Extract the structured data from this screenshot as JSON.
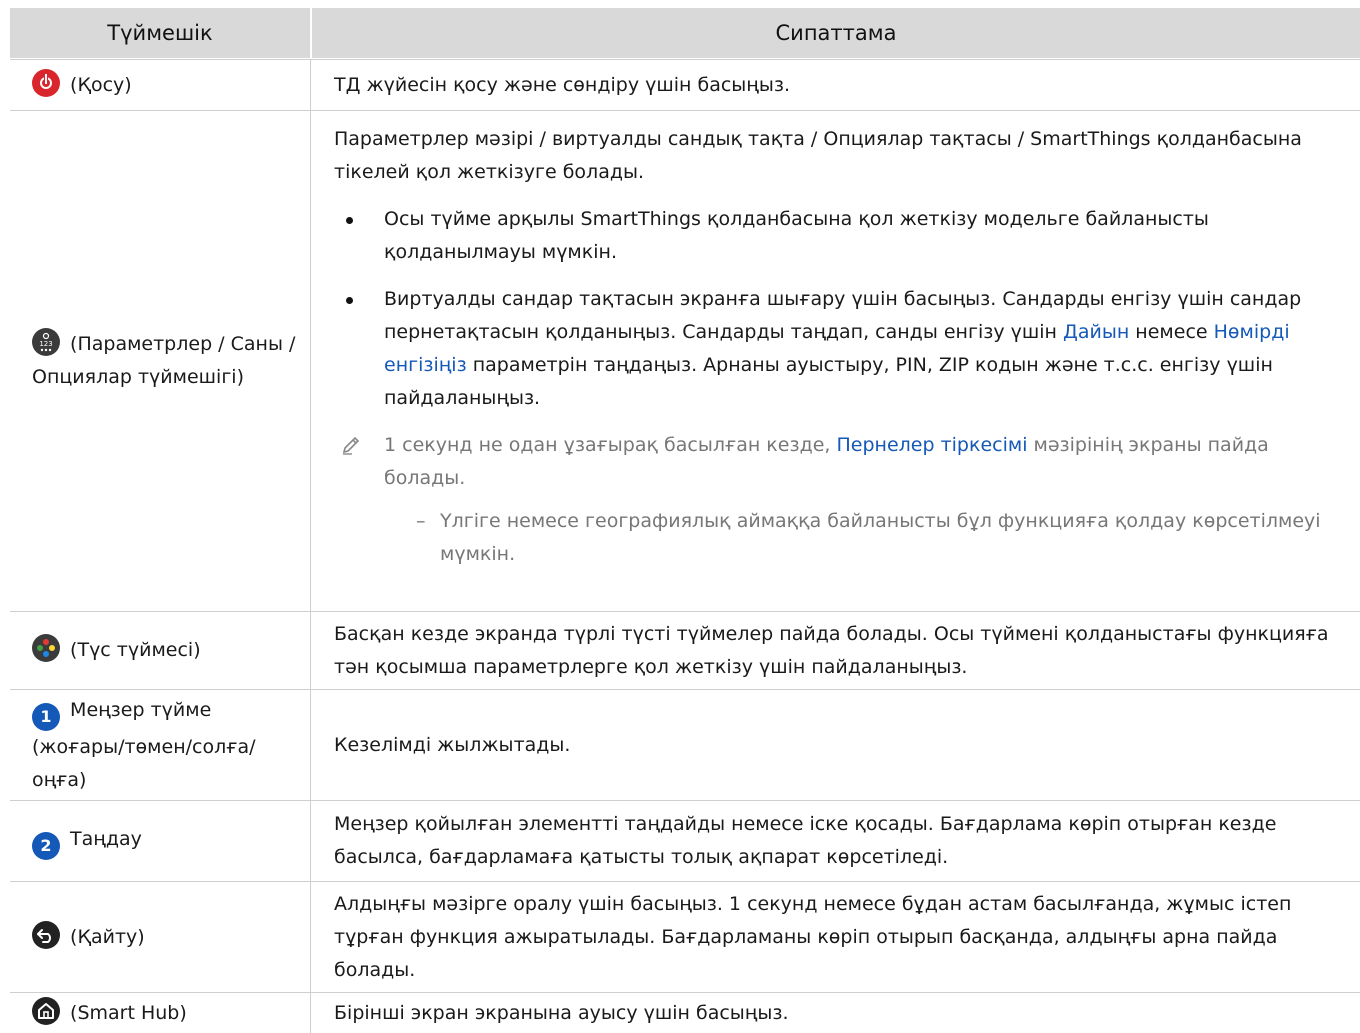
{
  "header": {
    "col1": "Түймешік",
    "col2": "Сипаттама"
  },
  "rows": {
    "power": {
      "label": "(Қосу)",
      "desc": "ТД жүйесін қосу және сөндіру үшін басыңыз."
    },
    "settings": {
      "label": "(Параметрлер / Саны / Опциялар түймешігі)",
      "desc": "Параметрлер мәзірі / виртуалды сандық тақта / Опциялар тақтасы / SmartThings қолданбасына тікелей қол жеткізуге болады.",
      "bullet1": "Осы түйме арқылы SmartThings қолданбасына қол жеткізу модельге байланысты қолданылмауы мүмкін.",
      "bullet2_a": "Виртуалды сандар тақтасын экранға шығару үшін басыңыз. Сандарды енгізу үшін сандар пернетақтасын қолданыңыз. Сандарды таңдап, санды енгізу үшін ",
      "bullet2_link1": "Дайын",
      "bullet2_b": " немесе ",
      "bullet2_link2": "Нөмірді енгізіңіз",
      "bullet2_c": " параметрін таңдаңыз. Арнаны ауыстыру, PIN, ZIP кодын және т.с.с. енгізу үшін пайдаланыңыз.",
      "note_a": "1 секунд не одан ұзағырақ басылған кезде, ",
      "note_link": "Пернелер тіркесімі",
      "note_b": " мәзірінің экраны пайда болады.",
      "dash_mark": "–",
      "dash": "Үлгіге немесе географиялық аймаққа байланысты бұл функцияға қолдау көрсетілмеуі мүмкін."
    },
    "color": {
      "label": "(Түс түймесі)",
      "desc": "Басқан кезде экранда түрлі түсті түймелер пайда болады. Осы түймені қолданыстағы функцияға тән қосымша параметрлерге қол жеткізу үшін пайдаланыңыз."
    },
    "direction": {
      "badge": "1",
      "label": "Меңзер түйме (жоғары/төмен/солға/оңға)",
      "desc": "Кезелімді жылжытады."
    },
    "select": {
      "badge": "2",
      "label": "Таңдау",
      "desc": "Меңзер қойылған элементті таңдайды немесе іске қосады. Бағдарлама көріп отырған кезде басылса, бағдарламаға қатысты толық ақпарат көрсетіледі."
    },
    "return": {
      "label": "(Қайту)",
      "desc": "Алдыңғы мәзірге оралу үшін басыңыз. 1 секунд немесе бұдан астам басылғанда, жұмыс істеп тұрған функция ажыратылады. Бағдарламаны көріп отырып басқанда, алдыңғы арна пайда болады."
    },
    "smarthub": {
      "label": "(Smart Hub)",
      "desc": "Бірінші экран экранына ауысу үшін басыңыз."
    }
  },
  "colors": {
    "header_bg": "#d9d9d9",
    "link": "#1458b8",
    "power_icon": "#d9262c",
    "number_badge": "#1458b8",
    "note_text": "#777777"
  },
  "icons": [
    "power-icon",
    "settings-numbers-icon",
    "color-buttons-icon",
    "number-1-badge",
    "number-2-badge",
    "return-icon",
    "home-icon",
    "pencil-note-icon"
  ]
}
